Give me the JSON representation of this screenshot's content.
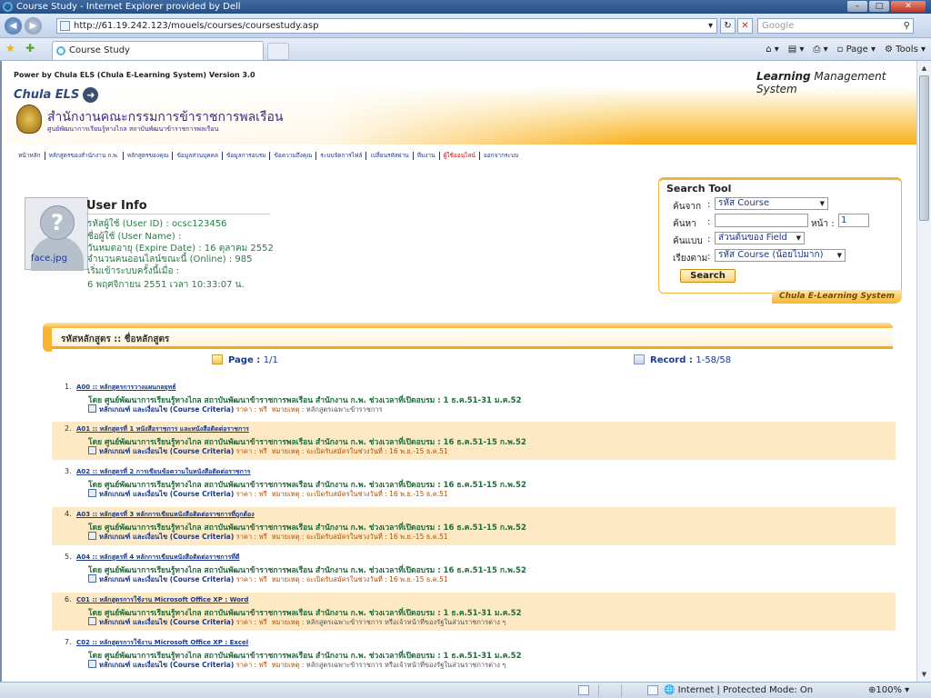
{
  "window": {
    "title": "Course Study - Internet Explorer provided by Dell",
    "min": "–",
    "max": "□",
    "close": "✕"
  },
  "address": {
    "url": "http://61.19.242.123/mouels/courses/coursestudy.asp",
    "search_placeholder": "Google"
  },
  "tabs": {
    "active_label": "Course Study"
  },
  "commands": {
    "page": "Page",
    "tools": "Tools"
  },
  "status": {
    "zone": "Internet | Protected Mode: On",
    "zoom": "100%"
  },
  "header": {
    "powered": "Power by Chula ELS (Chula E-Learning System) Version 3.0",
    "lms_bold": "Learning",
    "lms_rest": " Management System",
    "brand": "Chula ELS",
    "brand_right": "Chula E-Learning System",
    "org_name": "สำนักงานคณะกรรมการข้าราชการพลเรือน",
    "org_sub": "ศูนย์พัฒนาการเรียนรู้ทางไกล สถาบันพัฒนาข้าราชการพลเรือน"
  },
  "menu": [
    {
      "label": "หน้าหลัก",
      "red": false
    },
    {
      "label": "หลักสูตรของสำนักงาน ก.พ.",
      "red": false
    },
    {
      "label": "หลักสูตรของคุณ",
      "red": false
    },
    {
      "label": "ข้อมูลส่วนบุคคล",
      "red": false
    },
    {
      "label": "ข้อมูลการอบรม",
      "red": false
    },
    {
      "label": "ข้อความถึงคุณ",
      "red": false
    },
    {
      "label": "ระบบจัดการไฟล์",
      "red": false
    },
    {
      "label": "เปลี่ยนรหัสผ่าน",
      "red": false
    },
    {
      "label": "ทีมงาน",
      "red": false
    },
    {
      "label": "ผู้ใช้ออนไลน์",
      "red": true
    },
    {
      "label": "ออกจากระบบ",
      "red": false
    }
  ],
  "user": {
    "photo_label": "face.jpg",
    "title": "User Info",
    "id_label": "รหัสผู้ใช้ (User ID) :",
    "id_value": "ocsc123456",
    "name_label": "ชื่อผู้ใช้ (User Name) :",
    "expire_label": "วันหมดอายุ (Expire Date) :",
    "expire_value": "16 ตุลาคม 2552",
    "online_label": "จำนวนคนออนไลน์ขณะนี้ (Online) :",
    "online_value": "985",
    "start_label": "เริ่มเข้าระบบครั้งนี้เมื่อ :",
    "start_value": "6 พฤศจิกายน 2551 เวลา 10:33:07 น."
  },
  "search": {
    "title": "Search Tool",
    "from_label": "ค้นจาก",
    "from_value": "รหัส Course",
    "find_label": "ค้นหา",
    "page_label": "หน้า :",
    "page_value": "1",
    "mode_label": "ค้นแบบ",
    "mode_value": "ส่วนต้นของ Field",
    "sort_label": "เรียงตาม",
    "sort_value": "รหัส Course (น้อยไปมาก)",
    "colon": ":",
    "button": "Search",
    "footer": "Chula E-Learning System"
  },
  "list": {
    "header": "รหัสหลักสูตร :: ชื่อหลักสูตร",
    "page_label": "Page :",
    "page_value": "1/1",
    "record_label": "Record :",
    "record_value": "1-58/58"
  },
  "courses": [
    {
      "num": "1.",
      "name": "A00 :: หลักสูตรการวางแผนกลยุทธ์",
      "by": "โดย ศูนย์พัฒนาการเรียนรู้ทางไกล สถาบันพัฒนาข้าราชการพลเรือน สำนักงาน ก.พ.  ช่วงเวลาที่เปิดอบรม : 1 ธ.ค.51-31 ม.ค.52",
      "criteria": "หลักเกณฑ์ และเงื่อนไข (Course Criteria)",
      "price": "ราคา : ฟรี",
      "note_label": "หมายเหตุ :",
      "note": "หลักสูตรเฉพาะข้าราชการ"
    },
    {
      "num": "2.",
      "name": "A01 :: หลักสูตรที่ 1 หนังสือราชการ และหนังสือติดต่อราชการ",
      "by": "โดย ศูนย์พัฒนาการเรียนรู้ทางไกล สถาบันพัฒนาข้าราชการพลเรือน สำนักงาน ก.พ.  ช่วงเวลาที่เปิดอบรม : 16 ธ.ค.51-15 ก.พ.52",
      "criteria": "หลักเกณฑ์ และเงื่อนไข (Course Criteria)",
      "price": "ราคา : ฟรี",
      "note_label": "หมายเหตุ :",
      "note": "จะเปิดรับสมัครในช่วงวันที่ : 16 พ.ย.-15 ธ.ค.51"
    },
    {
      "num": "3.",
      "name": "A02 :: หลักสูตรที่ 2 การเขียนข้อความในหนังสือติดต่อราชการ",
      "by": "โดย ศูนย์พัฒนาการเรียนรู้ทางไกล สถาบันพัฒนาข้าราชการพลเรือน สำนักงาน ก.พ.  ช่วงเวลาที่เปิดอบรม : 16 ธ.ค.51-15 ก.พ.52",
      "criteria": "หลักเกณฑ์ และเงื่อนไข (Course Criteria)",
      "price": "ราคา : ฟรี",
      "note_label": "หมายเหตุ :",
      "note": "จะเปิดรับสมัครในช่วงวันที่ : 16 พ.ย.-15 ธ.ค.51"
    },
    {
      "num": "4.",
      "name": "A03 :: หลักสูตรที่ 3 หลักการเขียนหนังสือติดต่อราชการที่ถูกต้อง",
      "by": "โดย ศูนย์พัฒนาการเรียนรู้ทางไกล สถาบันพัฒนาข้าราชการพลเรือน สำนักงาน ก.พ.  ช่วงเวลาที่เปิดอบรม : 16 ธ.ค.51-15 ก.พ.52",
      "criteria": "หลักเกณฑ์ และเงื่อนไข (Course Criteria)",
      "price": "ราคา : ฟรี",
      "note_label": "หมายเหตุ :",
      "note": "จะเปิดรับสมัครในช่วงวันที่ : 16 พ.ย.-15 ธ.ค.51"
    },
    {
      "num": "5.",
      "name": "A04 :: หลักสูตรที่ 4 หลักการเขียนหนังสือติดต่อราชการที่ดี",
      "by": "โดย ศูนย์พัฒนาการเรียนรู้ทางไกล สถาบันพัฒนาข้าราชการพลเรือน สำนักงาน ก.พ.  ช่วงเวลาที่เปิดอบรม : 16 ธ.ค.51-15 ก.พ.52",
      "criteria": "หลักเกณฑ์ และเงื่อนไข (Course Criteria)",
      "price": "ราคา : ฟรี",
      "note_label": "หมายเหตุ :",
      "note": "จะเปิดรับสมัครในช่วงวันที่ : 16 พ.ย.-15 ธ.ค.51"
    },
    {
      "num": "6.",
      "name": "C01 :: หลักสูตรการใช้งาน Microsoft Office XP : Word",
      "by": "โดย ศูนย์พัฒนาการเรียนรู้ทางไกล สถาบันพัฒนาข้าราชการพลเรือน สำนักงาน ก.พ.  ช่วงเวลาที่เปิดอบรม : 1 ธ.ค.51-31 ม.ค.52",
      "criteria": "หลักเกณฑ์ และเงื่อนไข (Course Criteria)",
      "price": "ราคา : ฟรี",
      "note_label": "หมายเหตุ :",
      "note": "หลักสูตรเฉพาะข้าราชการ หรือเจ้าหน้าที่ของรัฐในส่วนราชการต่าง ๆ"
    },
    {
      "num": "7.",
      "name": "C02 :: หลักสูตรการใช้งาน Microsoft Office XP : Excel",
      "by": "โดย ศูนย์พัฒนาการเรียนรู้ทางไกล สถาบันพัฒนาข้าราชการพลเรือน สำนักงาน ก.พ.  ช่วงเวลาที่เปิดอบรม : 1 ธ.ค.51-31 ม.ค.52",
      "criteria": "หลักเกณฑ์ และเงื่อนไข (Course Criteria)",
      "price": "ราคา : ฟรี",
      "note_label": "หมายเหตุ :",
      "note": "หลักสูตรเฉพาะข้าราชการ หรือเจ้าหน้าที่ของรัฐในส่วนราชการต่าง ๆ"
    }
  ],
  "colors": {
    "accent_orange": "#f6b634",
    "link_blue": "#1b3a8c",
    "text_green": "#1f6b3a",
    "row_alt": "#fde9c4"
  }
}
